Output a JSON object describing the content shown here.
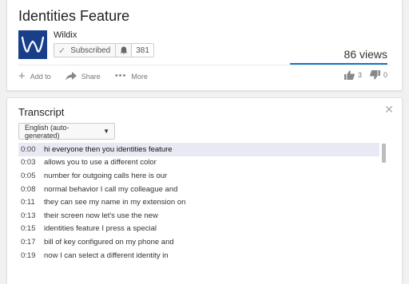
{
  "video": {
    "title": "Identities Feature",
    "channel": "Wildix",
    "subscribe_label": "Subscribed",
    "subscriber_count": "381",
    "views": "86 views",
    "actions": {
      "add_to": "Add to",
      "share": "Share",
      "more": "More"
    },
    "likes": "3",
    "dislikes": "0"
  },
  "transcript": {
    "title": "Transcript",
    "language": "English (auto-generated)",
    "lines": [
      {
        "time": "0:00",
        "text": "hi everyone then you identities feature"
      },
      {
        "time": "0:03",
        "text": "allows you to use a different color"
      },
      {
        "time": "0:05",
        "text": "number for outgoing calls here is our"
      },
      {
        "time": "0:08",
        "text": "normal behavior I call my colleague and"
      },
      {
        "time": "0:11",
        "text": "they can see my name in my extension on"
      },
      {
        "time": "0:13",
        "text": "their screen now let's use the new"
      },
      {
        "time": "0:15",
        "text": "identities feature I press a special"
      },
      {
        "time": "0:17",
        "text": "bill of key configured on my phone and"
      },
      {
        "time": "0:19",
        "text": "now I can select a different identity in"
      }
    ]
  },
  "colors": {
    "accent": "#167ac6",
    "logo_bg": "#1a3f8a",
    "active_line": "#e9e9f4"
  }
}
